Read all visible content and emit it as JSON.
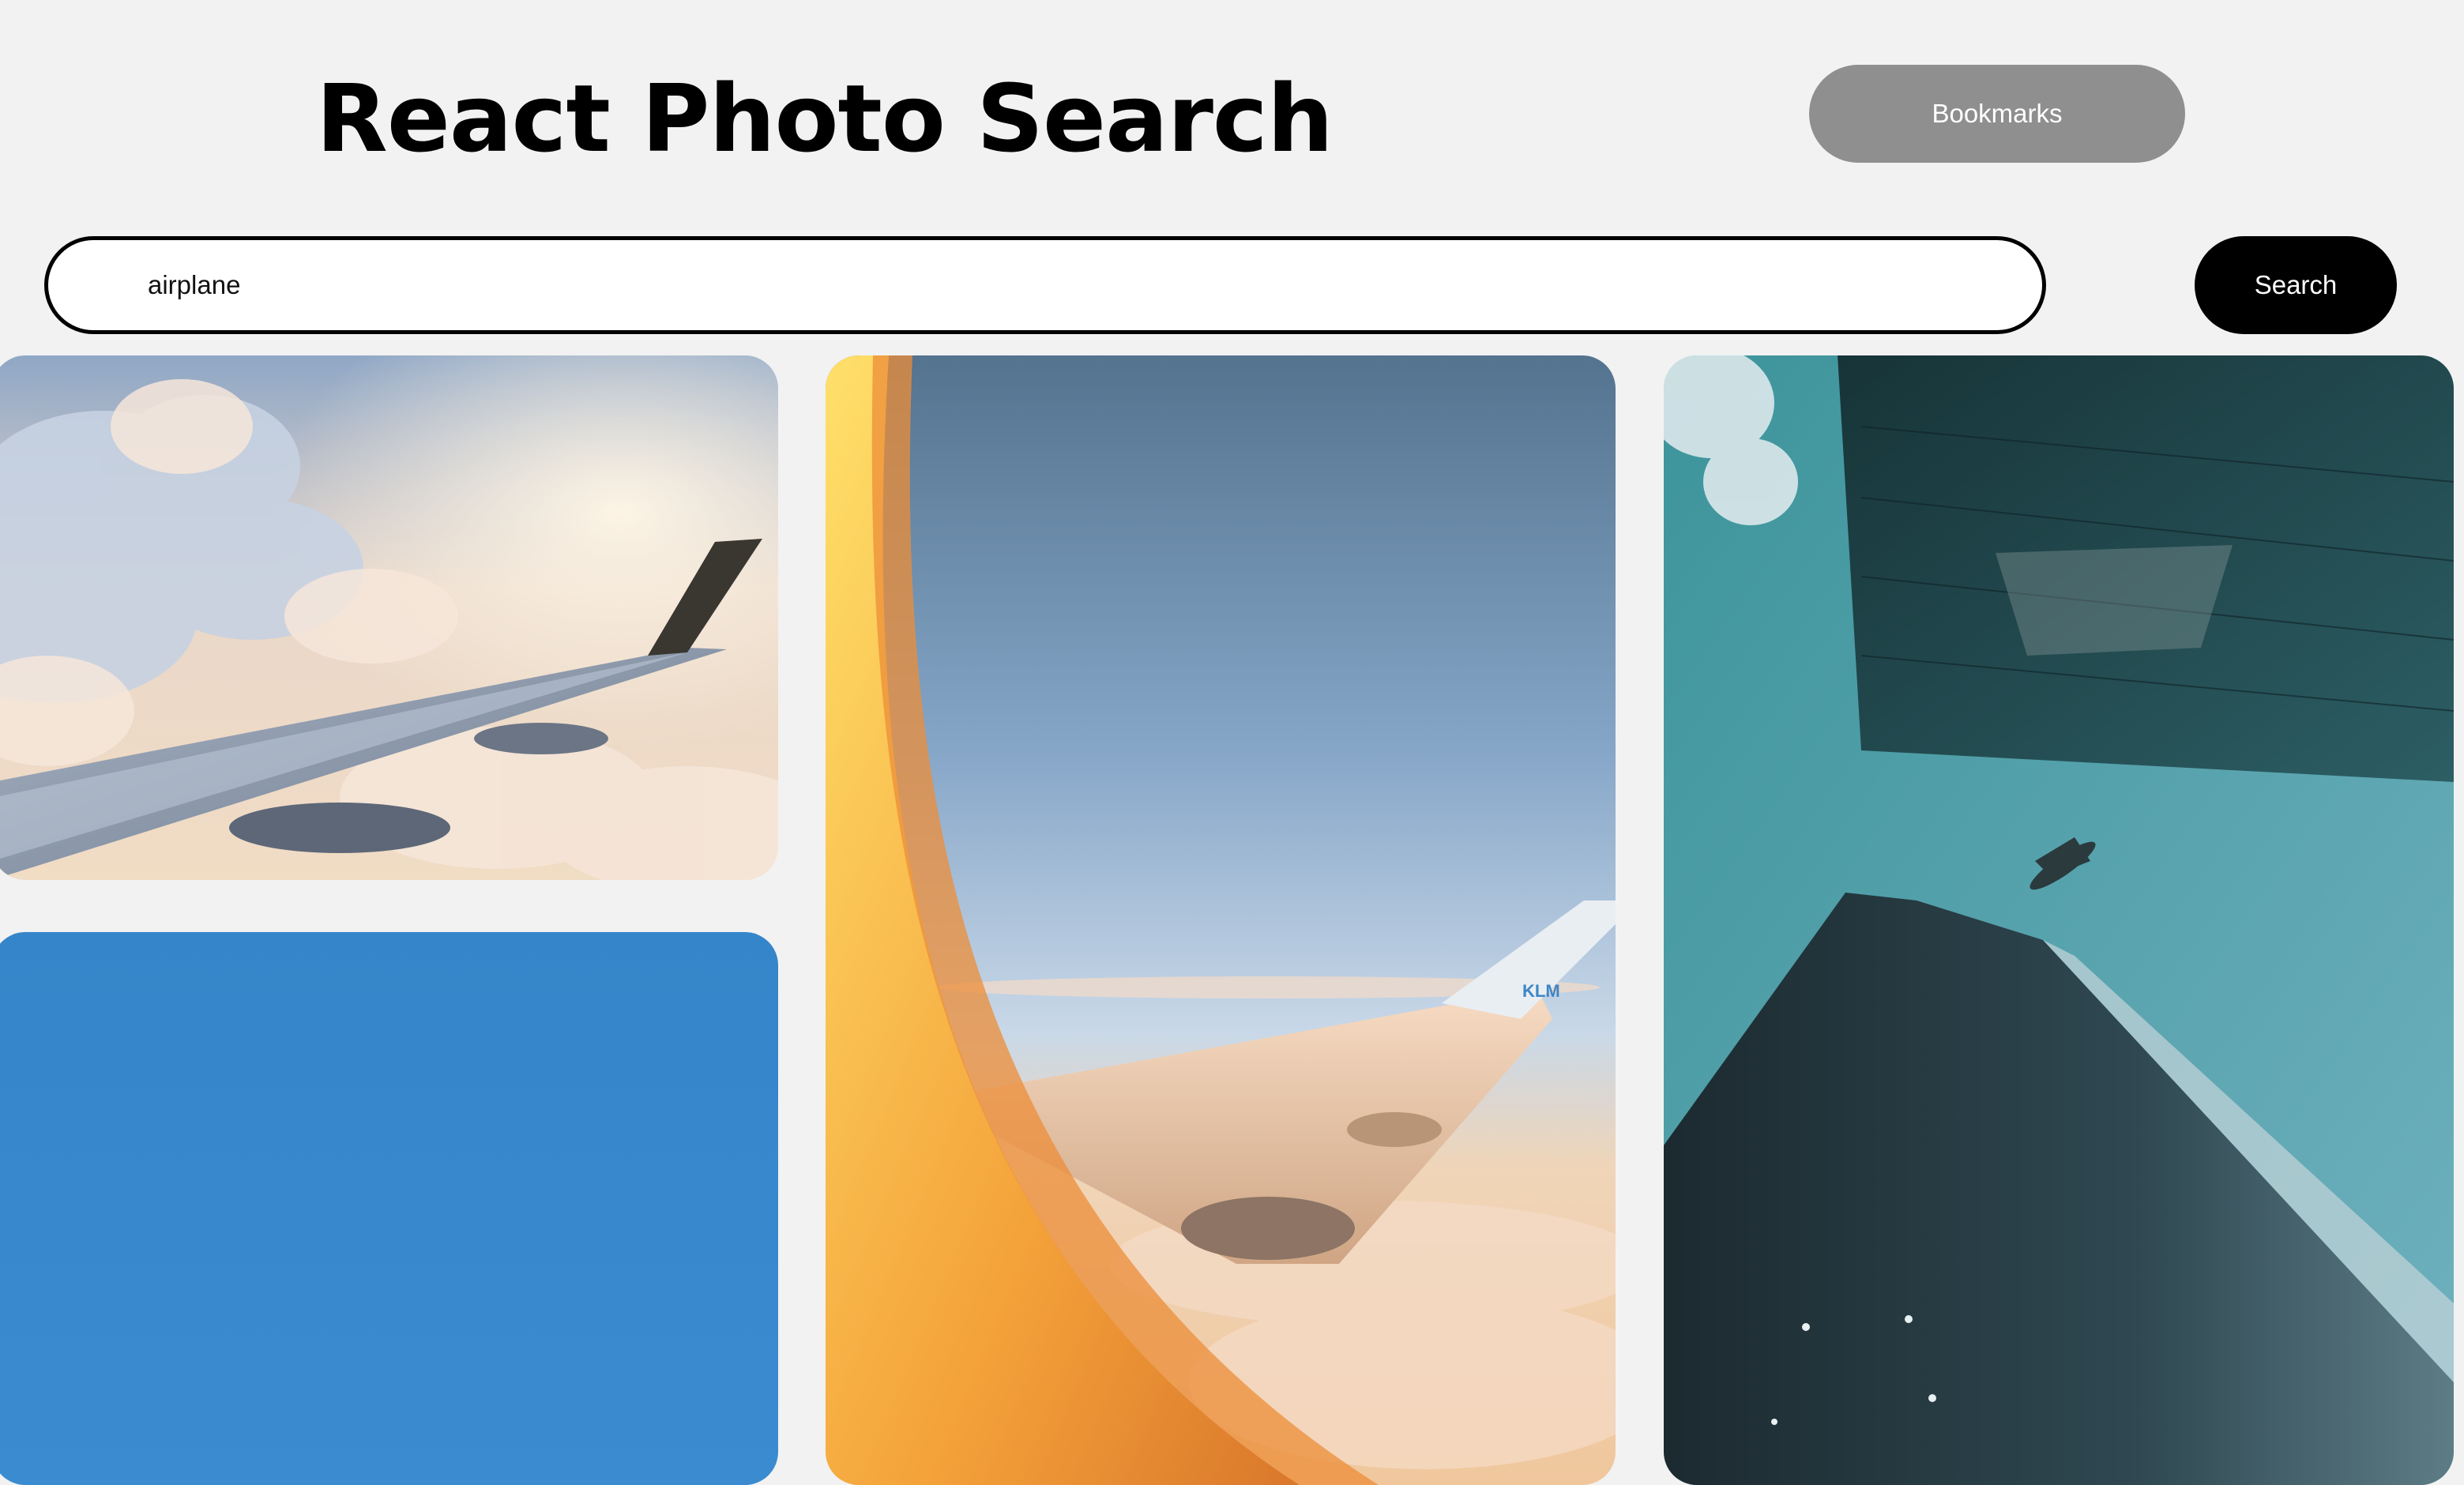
{
  "header": {
    "title": "React Photo Search",
    "bookmarks_label": "Bookmarks"
  },
  "search": {
    "value": "airplane",
    "button_label": "Search"
  },
  "results": [
    {
      "subject": "airplane wing above sunlit clouds"
    },
    {
      "subject": "clear blue sky"
    },
    {
      "subject": "KLM airplane wing seen through cabin window at sunset"
    },
    {
      "subject": "airplane flying between glass skyscrapers"
    }
  ],
  "colors": {
    "background": "#f2f2f2",
    "bookmarks_button": "#8f8f8f",
    "search_button": "#000000",
    "input_border": "#000000"
  }
}
